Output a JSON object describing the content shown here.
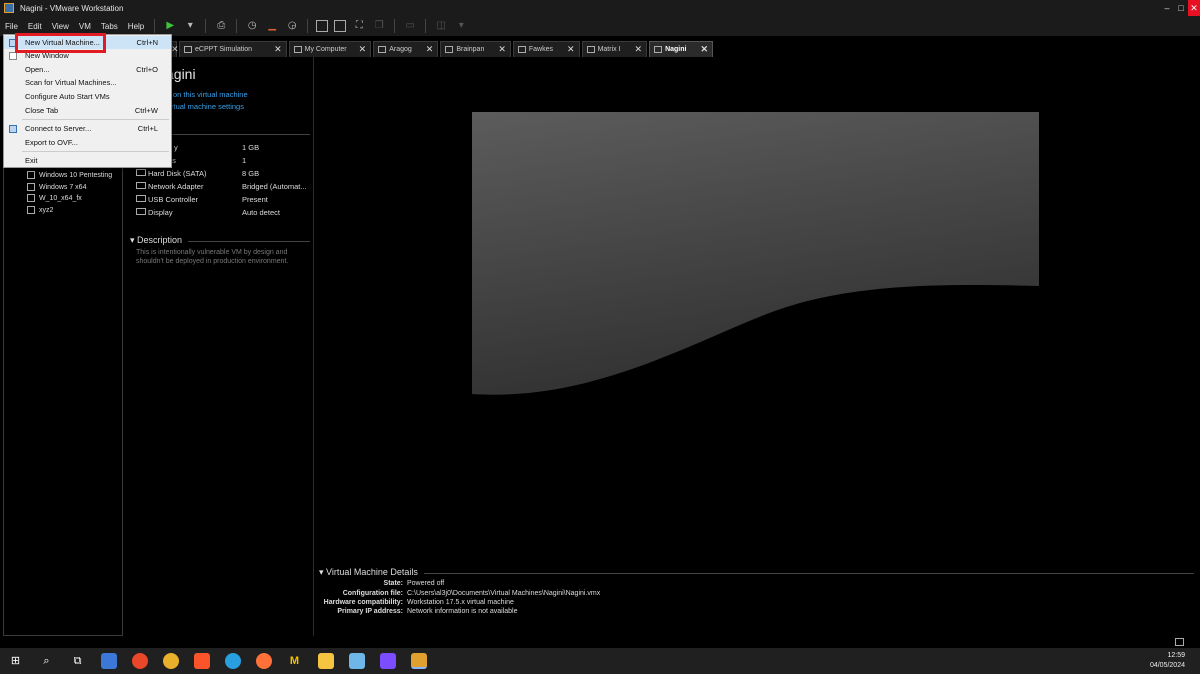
{
  "window": {
    "title": "Nagini - VMware Workstation",
    "minimize": "–",
    "maximize": "□",
    "close": "✕"
  },
  "menubar": {
    "items": [
      "File",
      "Edit",
      "View",
      "VM",
      "Tabs",
      "Help"
    ]
  },
  "toolbar": {
    "play": "▶",
    "dropdown": "▾"
  },
  "tabs": [
    {
      "label": "eCPPT Simulation",
      "active": false
    },
    {
      "label": "My Computer",
      "active": false
    },
    {
      "label": "Aragog",
      "active": false
    },
    {
      "label": "Brainpan",
      "active": false
    },
    {
      "label": "Fawkes",
      "active": false
    },
    {
      "label": "Matrix I",
      "active": false
    },
    {
      "label": "Nagini",
      "active": true
    }
  ],
  "tab_close": "✕",
  "library": {
    "items": [
      "Windows 10 Pentesting",
      "Windows 7 x64",
      "W_10_x64_fx",
      "xyz2"
    ]
  },
  "summary": {
    "title": "agini",
    "link_power": "on this virtual machine",
    "link_settings": "rtual machine settings",
    "devices": [
      {
        "name": "y",
        "value": "1 GB"
      },
      {
        "name": "ssors",
        "value": "1"
      },
      {
        "name": "Hard Disk (SATA)",
        "value": "8 GB"
      },
      {
        "name": "Network Adapter",
        "value": "Bridged (Automat..."
      },
      {
        "name": "USB Controller",
        "value": "Present"
      },
      {
        "name": "Display",
        "value": "Auto detect"
      }
    ],
    "description_head": "Description",
    "description": "This is intentionally vulnerable VM by design and shouldn't be deployed in production environment."
  },
  "details": {
    "head": "Virtual Machine Details",
    "rows": [
      {
        "key": "State:",
        "value": "Powered off"
      },
      {
        "key": "Configuration file:",
        "value": "C:\\Users\\al3j0\\Documents\\Virtual Machines\\Nagini\\Nagini.vmx"
      },
      {
        "key": "Hardware compatibility:",
        "value": "Workstation 17.5.x virtual machine"
      },
      {
        "key": "Primary IP address:",
        "value": "Network information is not available"
      }
    ]
  },
  "file_menu": {
    "items": [
      {
        "label": "New Virtual Machine...",
        "shortcut": "Ctrl+N",
        "hover": true
      },
      {
        "label": "New Window",
        "shortcut": ""
      },
      {
        "label": "Open...",
        "shortcut": "Ctrl+O"
      },
      {
        "label": "Scan for Virtual Machines...",
        "shortcut": ""
      },
      {
        "label": "Configure Auto Start VMs",
        "shortcut": ""
      },
      {
        "label": "Close Tab",
        "shortcut": "Ctrl+W"
      },
      {
        "label": "Connect to Server...",
        "shortcut": "Ctrl+L"
      },
      {
        "label": "Export to OVF...",
        "shortcut": ""
      },
      {
        "label": "Exit",
        "shortcut": ""
      }
    ]
  },
  "taskbar": {
    "icons": [
      "windows-start",
      "search",
      "task-view",
      "store",
      "brave-w",
      "chrome",
      "brave",
      "app-blue",
      "firefox",
      "malwarebytes",
      "file-explorer",
      "notepad",
      "obsidian",
      "vmware"
    ],
    "time": "12:59",
    "date": "04/05/2024"
  },
  "colors": {
    "accent_link": "#3aa0e8",
    "highlight": "#e01b24",
    "menu_hover": "#cde4f7"
  }
}
